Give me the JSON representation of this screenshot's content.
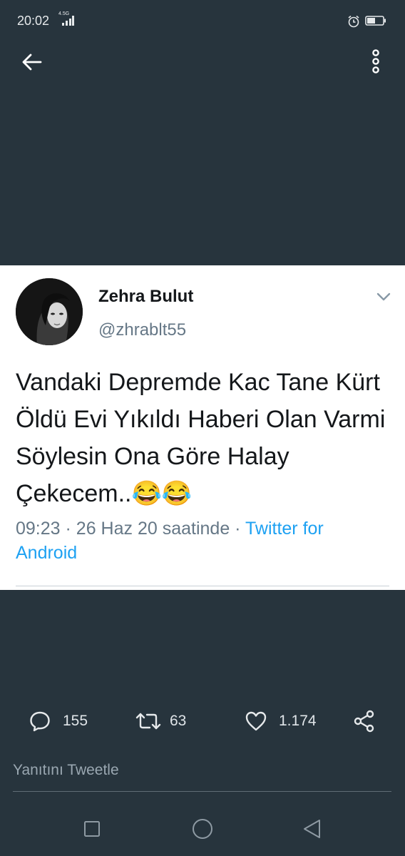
{
  "status_bar": {
    "time": "20:02",
    "network": "4.5G"
  },
  "tweet": {
    "author_name": "Zehra Bulut",
    "author_handle": "@zhrablt55",
    "text": "Vandaki Depremde Kac Tane Kürt Öldü Evi Yıkıldı Haberi Olan Varmi Söylesin Ona Göre Halay Çekecem..😂😂",
    "time": "09:23",
    "date_text": "· 26 Haz 20 saatinde ·",
    "source": "Twitter for Android"
  },
  "actions": {
    "replies": "155",
    "retweets": "63",
    "likes": "1.174"
  },
  "reply_placeholder": "Yanıtını Tweetle",
  "icons": {
    "back": "arrow-left-icon",
    "more": "more-vertical-icon",
    "caret": "chevron-down-icon",
    "reply": "comment-icon",
    "retweet": "retweet-icon",
    "like": "heart-icon",
    "share": "share-icon"
  },
  "colors": {
    "background": "#27343d",
    "card": "#ffffff",
    "link": "#1da1f2",
    "muted": "#657786"
  }
}
